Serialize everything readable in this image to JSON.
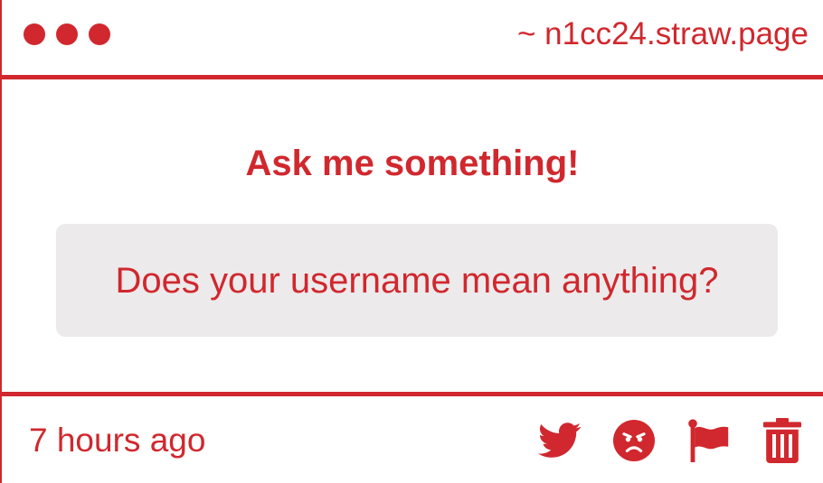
{
  "window": {
    "url": "~ n1cc24.straw.page",
    "dots": [
      "red-dot",
      "red-dot",
      "red-dot"
    ]
  },
  "main": {
    "title": "Ask me something!",
    "question": "Does your username mean anything?"
  },
  "footer": {
    "timestamp": "7 hours ago",
    "actions": [
      {
        "icon": "twitter-icon"
      },
      {
        "icon": "angry-face-icon"
      },
      {
        "icon": "flag-icon"
      },
      {
        "icon": "trash-icon"
      }
    ]
  },
  "colors": {
    "accent": "#d0282e",
    "question_bg": "#eceaeb",
    "background": "#ffffff"
  }
}
